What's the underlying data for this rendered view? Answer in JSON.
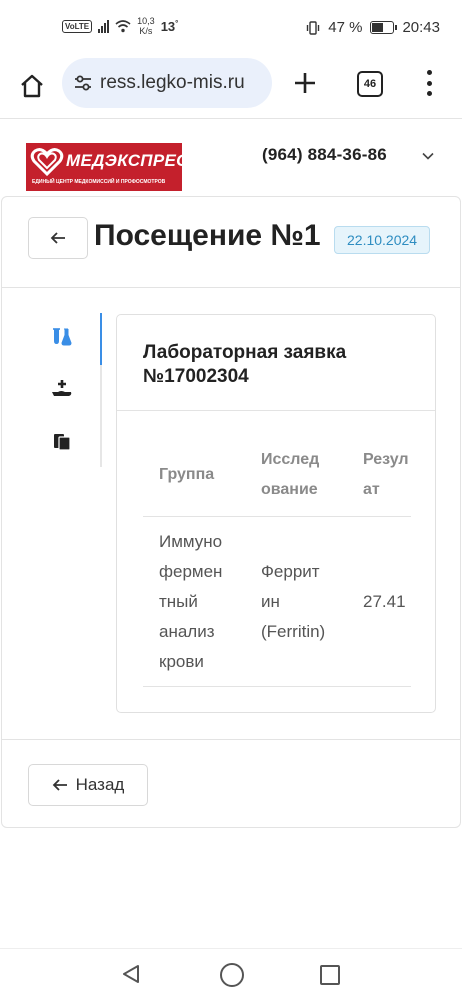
{
  "status_bar": {
    "volte": "VoLTE",
    "speed_value": "10,3",
    "speed_unit": "K/s",
    "temperature": "13",
    "temperature_unit": "°",
    "battery_percent": "47 %",
    "battery_level": 0.47,
    "time": "20:43"
  },
  "browser": {
    "url": "ress.legko-mis.ru",
    "tab_count": "46",
    "home_icon": "home-icon",
    "tune_icon": "site-settings-icon",
    "new_tab_icon": "plus-icon",
    "menu_icon": "more-vert-icon"
  },
  "header": {
    "logo_title": "МЕДЭКСПРЕСС",
    "logo_subtitle": "ЕДИНЫЙ ЦЕНТР МЕДКОМИССИЙ И ПРОФОСМОТРОВ",
    "phone": "(964) 884-36-86",
    "brand_color": "#c4202c"
  },
  "visit": {
    "title": "Посещение №1",
    "date": "22.10.2024",
    "back_icon": "arrow-left-icon"
  },
  "sidebar": {
    "items": [
      {
        "icon": "lab-flask-icon",
        "active": true
      },
      {
        "icon": "hand-plus-icon",
        "active": false
      },
      {
        "icon": "documents-icon",
        "active": false
      }
    ],
    "active_color": "#3a8ee6"
  },
  "lab_order": {
    "title": "Лабораторная заявка №17002304",
    "columns": {
      "group": "Группа",
      "study": "Исслед\nование",
      "result": "Резул\nат"
    },
    "rows": [
      {
        "group": "Иммуно\nфермен\nтный\nанализ\nкрови",
        "study": "Феррит\nин\n(Ferritin)",
        "result": "27.41"
      }
    ]
  },
  "footer": {
    "back_label": "Назад"
  }
}
